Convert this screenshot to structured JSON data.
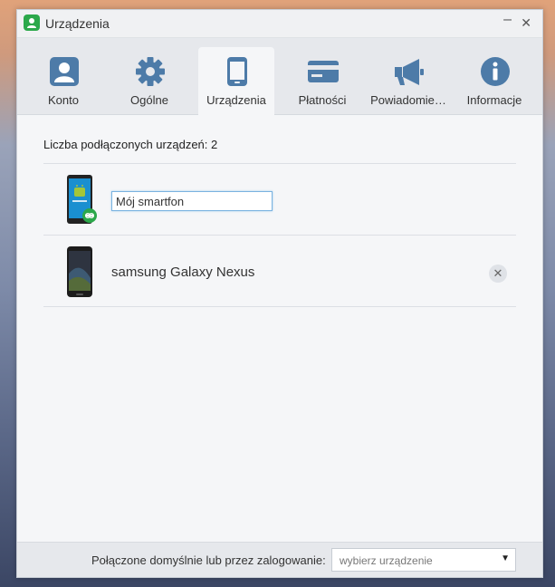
{
  "window": {
    "title": "Urządzenia"
  },
  "tabs": [
    {
      "label": "Konto",
      "icon": "user-icon"
    },
    {
      "label": "Ogólne",
      "icon": "gear-icon"
    },
    {
      "label": "Urządzenia",
      "icon": "tablet-icon"
    },
    {
      "label": "Płatności",
      "icon": "credit-card-icon"
    },
    {
      "label": "Powiadomie…",
      "icon": "megaphone-icon"
    },
    {
      "label": "Informacje",
      "icon": "info-icon"
    }
  ],
  "active_tab": "Urządzenia",
  "devices": {
    "count_label": "Liczba podłączonych urządzeń: 2",
    "items": [
      {
        "name": "Mój smartfon",
        "editing": true,
        "icon": "android-phone-icon"
      },
      {
        "name": "samsung Galaxy Nexus",
        "editing": false,
        "icon": "phone-icon"
      }
    ]
  },
  "footer": {
    "label": "Połączone domyślnie lub przez zalogowanie:",
    "select_placeholder": "wybierz urządzenie"
  },
  "colors": {
    "accent": "#2ba84a",
    "icon_blue": "#4d7ba8",
    "input_focus": "#7ab3e0"
  }
}
